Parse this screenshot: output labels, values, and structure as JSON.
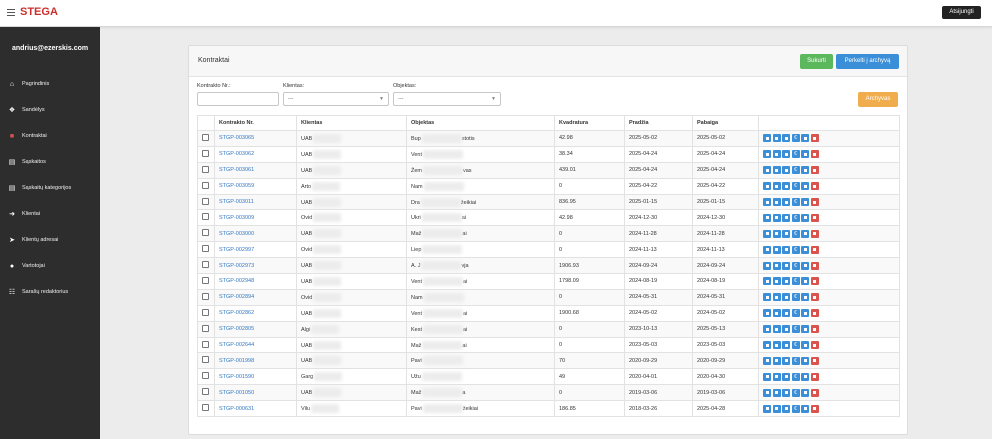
{
  "header": {
    "brand": "STEGA",
    "logout_label": "Atsijungti"
  },
  "sidebar": {
    "user_email": "andrius@ezerskis.com",
    "items": [
      {
        "label": "Pagrindinis",
        "icon": "home-icon",
        "glyph": "⌂"
      },
      {
        "label": "Sandėlys",
        "icon": "cubes-icon",
        "glyph": "❖"
      },
      {
        "label": "Kontraktai",
        "icon": "book-icon",
        "glyph": "■"
      },
      {
        "label": "Sąskaitos",
        "icon": "file-icon",
        "glyph": "▤"
      },
      {
        "label": "Sąskaitų kategorijos",
        "icon": "files-icon",
        "glyph": "▤"
      },
      {
        "label": "Klientai",
        "icon": "arrow-right-icon",
        "glyph": "➜"
      },
      {
        "label": "Klientų adresai",
        "icon": "location-arrow-icon",
        "glyph": "➤"
      },
      {
        "label": "Vartotojai",
        "icon": "users-icon",
        "glyph": "●"
      },
      {
        "label": "Sarašų redaktorius",
        "icon": "list-icon",
        "glyph": "☷"
      }
    ],
    "active_index": 2
  },
  "panel": {
    "title": "Kontraktai",
    "create_label": "Sukurti",
    "archive_move_label": "Perkelti į archyvą",
    "archive_label": "Archyvas"
  },
  "filters": {
    "contract_label": "Kontrakto Nr.:",
    "contract_value": "",
    "client_label": "Klientas:",
    "client_value": "---",
    "object_label": "Objektas:",
    "object_value": "---"
  },
  "table": {
    "columns": [
      "Kontrakto Nr.",
      "Klientas",
      "Objektas",
      "Kvadratura",
      "Pradžia",
      "Pabaiga"
    ],
    "rows": [
      {
        "nr": "STGP-003065",
        "client": "UAB",
        "object": "Bup",
        "object_tail": "stotis",
        "area": "42.98",
        "start": "2025-05-02",
        "end": "2025-05-02"
      },
      {
        "nr": "STGP-003062",
        "client": "UAB",
        "object": "Vent",
        "object_tail": "",
        "area": "38.34",
        "start": "2025-04-24",
        "end": "2025-04-24"
      },
      {
        "nr": "STGP-003061",
        "client": "UAB",
        "object": "Žem",
        "object_tail": "vas",
        "area": "439.01",
        "start": "2025-04-24",
        "end": "2025-04-24"
      },
      {
        "nr": "STGP-003059",
        "client": "Arto",
        "object": "Nam",
        "object_tail": "",
        "area": "0",
        "start": "2025-04-22",
        "end": "2025-04-22"
      },
      {
        "nr": "STGP-003011",
        "client": "UAB",
        "object": "Dra",
        "object_tail": "žeikiai",
        "area": "836.95",
        "start": "2025-01-15",
        "end": "2025-01-15"
      },
      {
        "nr": "STGP-003009",
        "client": "Ovid",
        "object": "Ukri",
        "object_tail": "ai",
        "area": "42.98",
        "start": "2024-12-30",
        "end": "2024-12-30"
      },
      {
        "nr": "STGP-003000",
        "client": "UAB",
        "object": "Maž",
        "object_tail": "ai",
        "area": "0",
        "start": "2024-11-28",
        "end": "2024-11-28"
      },
      {
        "nr": "STGP-002997",
        "client": "Ovid",
        "object": "Liep",
        "object_tail": "",
        "area": "0",
        "start": "2024-11-13",
        "end": "2024-11-13"
      },
      {
        "nr": "STGP-002973",
        "client": "UAB",
        "object": "A. J",
        "object_tail": "vja",
        "area": "1906.93",
        "start": "2024-09-24",
        "end": "2024-09-24"
      },
      {
        "nr": "STGP-002948",
        "client": "UAB",
        "object": "Vent",
        "object_tail": "ai",
        "area": "1798.09",
        "start": "2024-08-19",
        "end": "2024-08-19"
      },
      {
        "nr": "STGP-002894",
        "client": "Ovid",
        "object": "Nam",
        "object_tail": "",
        "area": "0",
        "start": "2024-05-31",
        "end": "2024-05-31"
      },
      {
        "nr": "STGP-002862",
        "client": "UAB",
        "object": "Vent",
        "object_tail": "ai",
        "area": "1900.68",
        "start": "2024-05-02",
        "end": "2024-05-02"
      },
      {
        "nr": "STGP-002805",
        "client": "Algi",
        "object": "Kest",
        "object_tail": "ai",
        "area": "0",
        "start": "2023-10-13",
        "end": "2025-05-13"
      },
      {
        "nr": "STGP-002644",
        "client": "UAB",
        "object": "Maž",
        "object_tail": "ai",
        "area": "0",
        "start": "2023-05-03",
        "end": "2023-05-03"
      },
      {
        "nr": "STGP-001998",
        "client": "UAB",
        "object": "Pavi",
        "object_tail": "",
        "area": "70",
        "start": "2020-09-29",
        "end": "2020-09-29"
      },
      {
        "nr": "STGP-001590",
        "client": "Garg",
        "object": "Užu",
        "object_tail": "",
        "area": "49",
        "start": "2020-04-01",
        "end": "2020-04-30"
      },
      {
        "nr": "STGP-001050",
        "client": "UAB",
        "object": "Maž",
        "object_tail": "a",
        "area": "0",
        "start": "2019-03-06",
        "end": "2019-03-06"
      },
      {
        "nr": "STGP-000631",
        "client": "Vilu",
        "object": "Pavi",
        "object_tail": "žeikiai",
        "area": "186.85",
        "start": "2018-03-26",
        "end": "2025-04-28"
      }
    ],
    "actions": [
      {
        "name": "print-icon",
        "color": "#3a8fd8"
      },
      {
        "name": "view-icon",
        "color": "#3a8fd8"
      },
      {
        "name": "document-icon",
        "color": "#3a8fd8"
      },
      {
        "name": "euro-icon",
        "color": "#3a8fd8",
        "glyph": "€"
      },
      {
        "name": "edit-icon",
        "color": "#3a8fd8"
      },
      {
        "name": "trash-icon",
        "color": "#d9534f"
      }
    ]
  }
}
